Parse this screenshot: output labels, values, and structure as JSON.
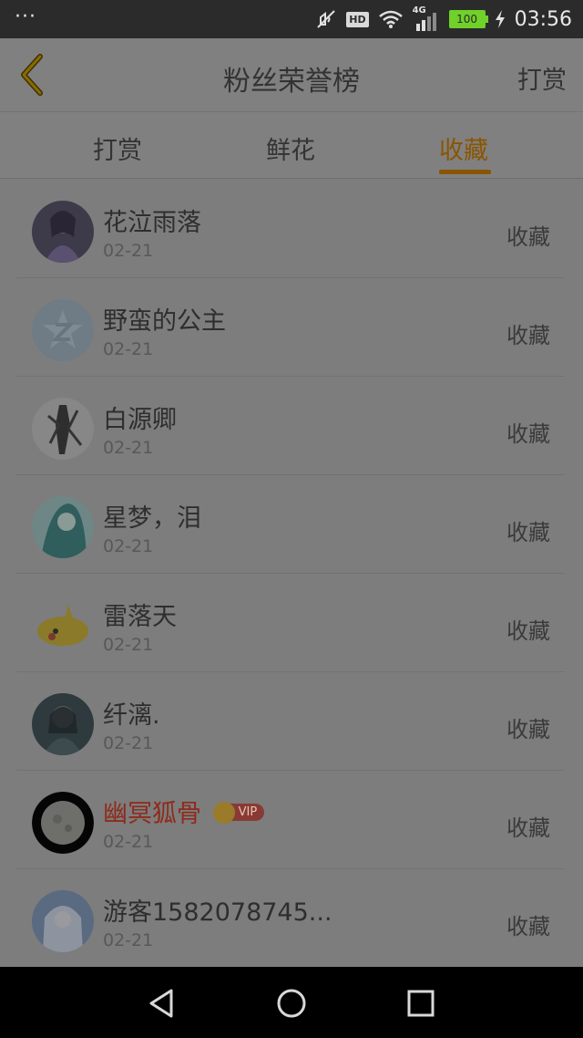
{
  "status_bar": {
    "left_indicator": "···",
    "network": "4G",
    "hd": "HD",
    "battery": "100",
    "time": "03:56"
  },
  "header": {
    "title": "粉丝荣誉榜",
    "right_action": "打赏"
  },
  "tabs": [
    {
      "label": "打赏",
      "active": false
    },
    {
      "label": "鲜花",
      "active": false
    },
    {
      "label": "收藏",
      "active": true
    }
  ],
  "rows": [
    {
      "name": "花泣雨落",
      "date": "02-21",
      "action": "收藏",
      "avatar": "anime-girl-avatar"
    },
    {
      "name": "野蛮的公主",
      "date": "02-21",
      "action": "收藏",
      "avatar": "default-q-avatar"
    },
    {
      "name": "白源卿",
      "date": "02-21",
      "action": "收藏",
      "avatar": "sketch-character-avatar"
    },
    {
      "name": "星梦，泪",
      "date": "02-21",
      "action": "收藏",
      "avatar": "teal-hair-avatar"
    },
    {
      "name": "雷落天",
      "date": "02-21",
      "action": "收藏",
      "avatar": "pikachu-avatar"
    },
    {
      "name": "纤漓.",
      "date": "02-21",
      "action": "收藏",
      "avatar": "dark-character-avatar"
    },
    {
      "name": "幽冥狐骨",
      "date": "02-21",
      "action": "收藏",
      "avatar": "moon-avatar",
      "vip": "VIP"
    },
    {
      "name": "游客1582078745...",
      "date": "02-21",
      "action": "收藏",
      "avatar": "white-hair-avatar"
    }
  ],
  "colors": {
    "accent": "#8a5500",
    "vip_name": "#8e2a1a"
  },
  "nav": {
    "back": "back-triangle-icon",
    "home": "home-circle-icon",
    "recents": "recents-square-icon"
  }
}
